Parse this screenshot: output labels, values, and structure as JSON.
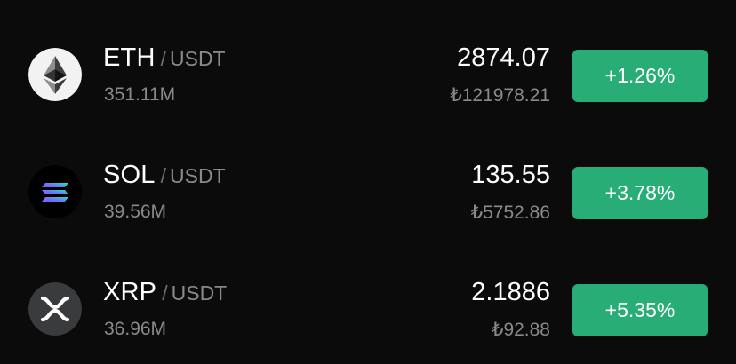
{
  "markets": [
    {
      "base": "ETH",
      "separator": "/",
      "quote": "USDT",
      "volume": "351.11M",
      "price": "2874.07",
      "fiat_price": "₺121978.21",
      "change": "+1.26%",
      "icon": "ethereum-icon",
      "change_color": "#27ad75"
    },
    {
      "base": "SOL",
      "separator": "/",
      "quote": "USDT",
      "volume": "39.56M",
      "price": "135.55",
      "fiat_price": "₺5752.86",
      "change": "+3.78%",
      "icon": "solana-icon",
      "change_color": "#27ad75"
    },
    {
      "base": "XRP",
      "separator": "/",
      "quote": "USDT",
      "volume": "36.96M",
      "price": "2.1886",
      "fiat_price": "₺92.88",
      "change": "+5.35%",
      "icon": "xrp-icon",
      "change_color": "#27ad75"
    }
  ],
  "colors": {
    "background": "#0b0b0b",
    "positive": "#27ad75",
    "primary_text": "#ffffff",
    "secondary_text": "#8a8a8a"
  }
}
